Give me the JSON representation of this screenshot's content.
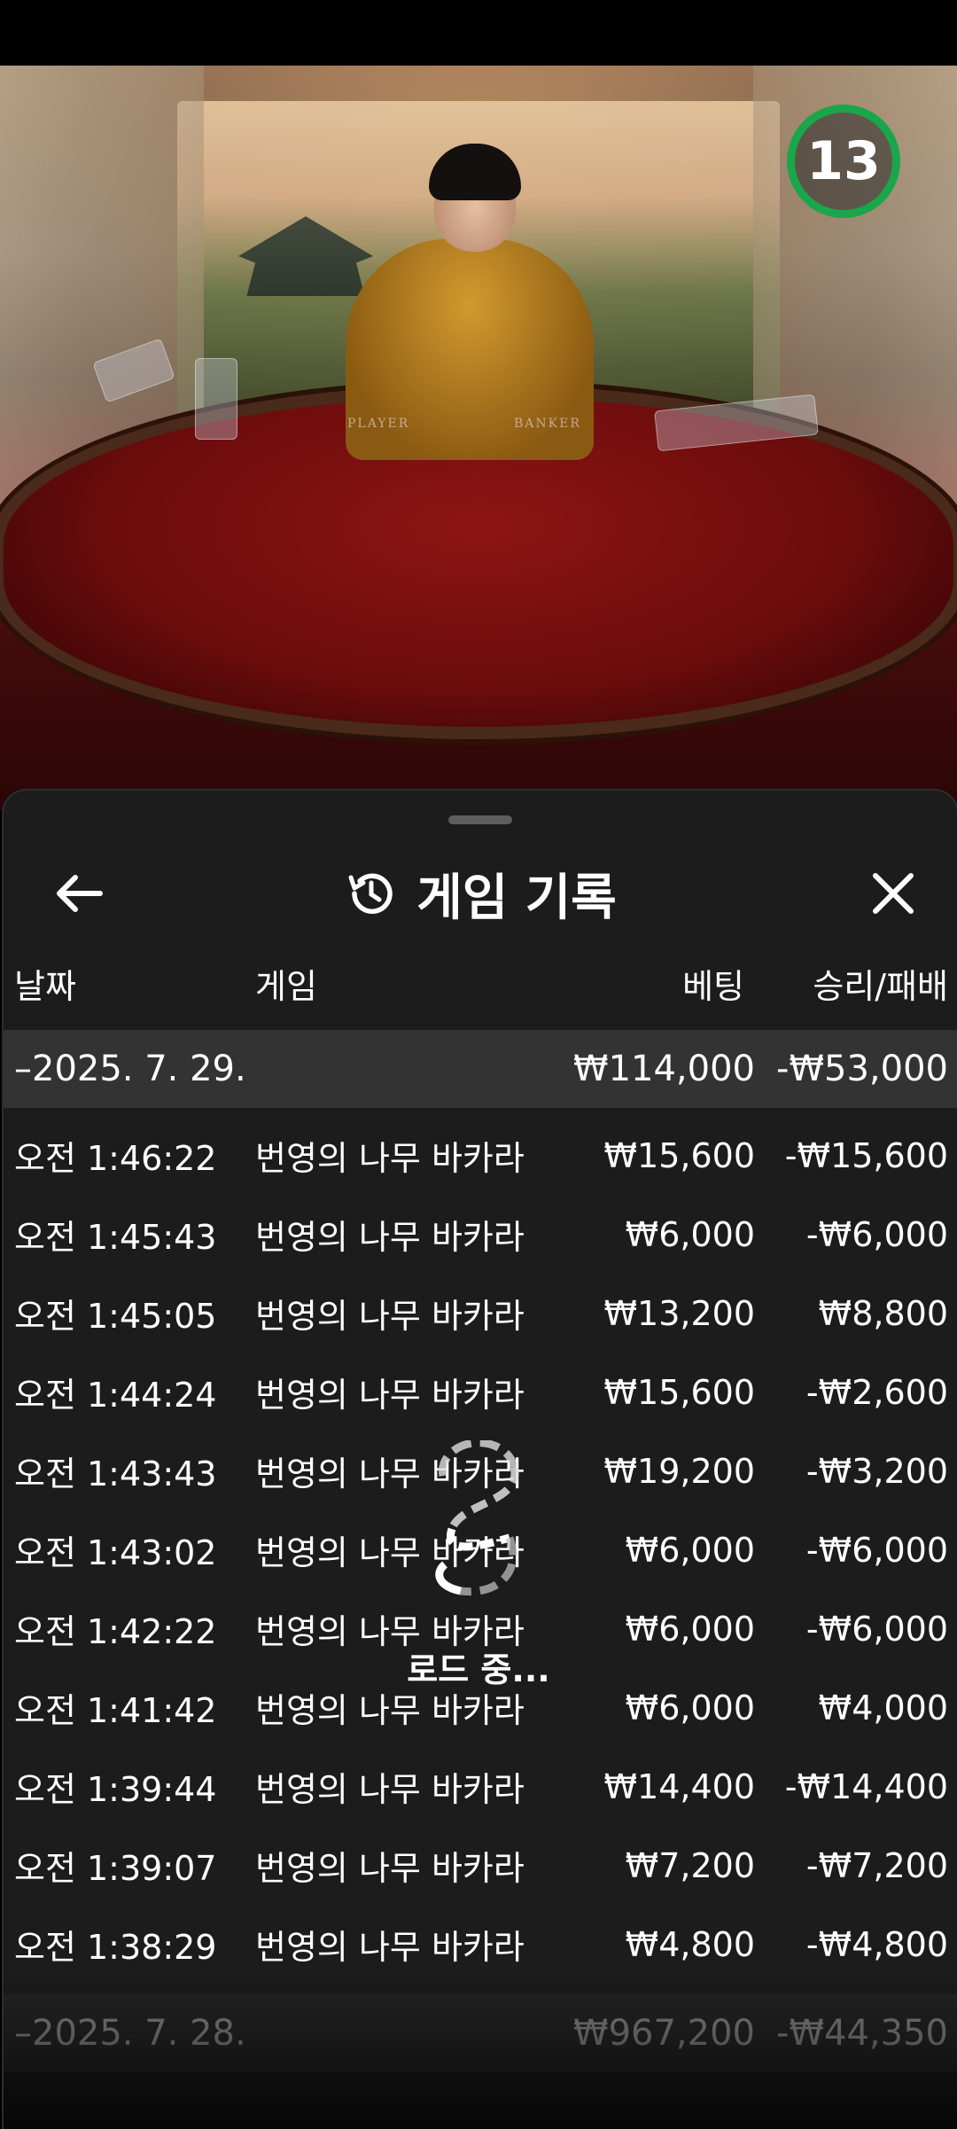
{
  "timer": {
    "seconds": "13",
    "color": "#1aa64a"
  },
  "video": {
    "labels": {
      "player": "PLAYER",
      "banker": "BANKER"
    }
  },
  "history": {
    "title": "게임 기록",
    "icons": {
      "back": "arrow-left-icon",
      "history": "history-clock-icon",
      "close": "close-x-icon"
    },
    "columns": {
      "date": "날짜",
      "game": "게임",
      "bet": "베팅",
      "winloss": "승리/패배"
    },
    "groups": [
      {
        "date": "–2025. 7. 29.",
        "bet_total": "₩114,000",
        "winloss_total": "-₩53,000",
        "rows": [
          {
            "time": "오전 1:46:22",
            "game": "번영의 나무 바카라",
            "bet": "₩15,600",
            "winloss": "-₩15,600"
          },
          {
            "time": "오전 1:45:43",
            "game": "번영의 나무 바카라",
            "bet": "₩6,000",
            "winloss": "-₩6,000"
          },
          {
            "time": "오전 1:45:05",
            "game": "번영의 나무 바카라",
            "bet": "₩13,200",
            "winloss": "₩8,800"
          },
          {
            "time": "오전 1:44:24",
            "game": "번영의 나무 바카라",
            "bet": "₩15,600",
            "winloss": "-₩2,600"
          },
          {
            "time": "오전 1:43:43",
            "game": "번영의 나무 바카라",
            "bet": "₩19,200",
            "winloss": "-₩3,200"
          },
          {
            "time": "오전 1:43:02",
            "game": "번영의 나무 바카라",
            "bet": "₩6,000",
            "winloss": "-₩6,000"
          },
          {
            "time": "오전 1:42:22",
            "game": "번영의 나무 바카라",
            "bet": "₩6,000",
            "winloss": "-₩6,000"
          },
          {
            "time": "오전 1:41:42",
            "game": "번영의 나무 바카라",
            "bet": "₩6,000",
            "winloss": "₩4,000"
          },
          {
            "time": "오전 1:39:44",
            "game": "번영의 나무 바카라",
            "bet": "₩14,400",
            "winloss": "-₩14,400"
          },
          {
            "time": "오전 1:39:07",
            "game": "번영의 나무 바카라",
            "bet": "₩7,200",
            "winloss": "-₩7,200"
          },
          {
            "time": "오전 1:38:29",
            "game": "번영의 나무 바카라",
            "bet": "₩4,800",
            "winloss": "-₩4,800"
          }
        ]
      },
      {
        "date": "–2025. 7. 28.",
        "bet_total": "₩967,200",
        "winloss_total": "-₩44,350",
        "rows": []
      }
    ],
    "loading_text": "로드 중..."
  }
}
